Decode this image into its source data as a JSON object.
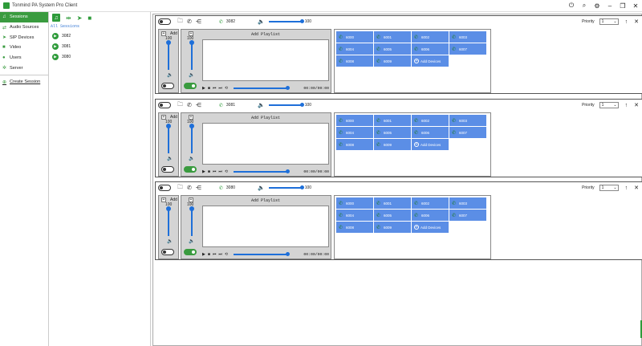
{
  "window": {
    "title": "Tonmind PA System Pro Client",
    "controls": [
      "power-icon",
      "search-icon",
      "gear-icon",
      "minimize-icon",
      "restore-icon",
      "close-icon"
    ]
  },
  "nav": {
    "items": [
      {
        "label": "Sessions",
        "icon": "music-note-icon",
        "active": true
      },
      {
        "label": "Audio Sources",
        "icon": "audio-source-icon",
        "active": false
      },
      {
        "label": "SIP Devices",
        "icon": "send-icon",
        "active": false
      },
      {
        "label": "Video",
        "icon": "video-icon",
        "active": false
      },
      {
        "label": "Users",
        "icon": "user-icon",
        "active": false
      },
      {
        "label": "Server",
        "icon": "server-icon",
        "active": false
      }
    ],
    "create_session": "Create Session"
  },
  "sessions_pane": {
    "all_label": "All Sessions",
    "toolbar_icons": [
      "music-note-icon",
      "link-icon",
      "send-icon",
      "video-icon"
    ],
    "items": [
      "3082",
      "3081",
      "3080"
    ]
  },
  "session_panels": [
    {
      "session_id": "3082",
      "volume": 100,
      "priority_label": "Priority",
      "priority_value": "1",
      "left_add": "Add",
      "left_volume": "100",
      "mid_volume": "100",
      "playlist_label": "Add Playlist",
      "time": "00:00/00:00",
      "devices": [
        "6000",
        "6001",
        "6002",
        "6003",
        "6004",
        "6005",
        "6006",
        "6007",
        "6008",
        "6009"
      ],
      "add_devices": "Add Devices",
      "left_toggle_on": false,
      "mid_toggle_on": true
    },
    {
      "session_id": "3081",
      "volume": 100,
      "priority_label": "Priority",
      "priority_value": "1",
      "left_add": "Add",
      "left_volume": "100",
      "mid_volume": "100",
      "playlist_label": "Add Playlist",
      "time": "00:00/00:00",
      "devices": [
        "6000",
        "6001",
        "6002",
        "6003",
        "6004",
        "6005",
        "6006",
        "6007",
        "6008",
        "6009"
      ],
      "add_devices": "Add Devices",
      "left_toggle_on": false,
      "mid_toggle_on": true
    },
    {
      "session_id": "3080",
      "volume": 100,
      "priority_label": "Priority",
      "priority_value": "1",
      "left_add": "Add",
      "left_volume": "100",
      "mid_volume": "100",
      "playlist_label": "Add Playlist",
      "time": "00:00/00:00",
      "devices": [
        "6000",
        "6001",
        "6002",
        "6003",
        "6004",
        "6005",
        "6006",
        "6007",
        "6008",
        "6009"
      ],
      "add_devices": "Add Devices",
      "left_toggle_on": false,
      "mid_toggle_on": true
    }
  ],
  "colors": {
    "accent_green": "#3a9b3f",
    "device_blue": "#5b8ee6",
    "slider_blue": "#1e6fd9"
  }
}
